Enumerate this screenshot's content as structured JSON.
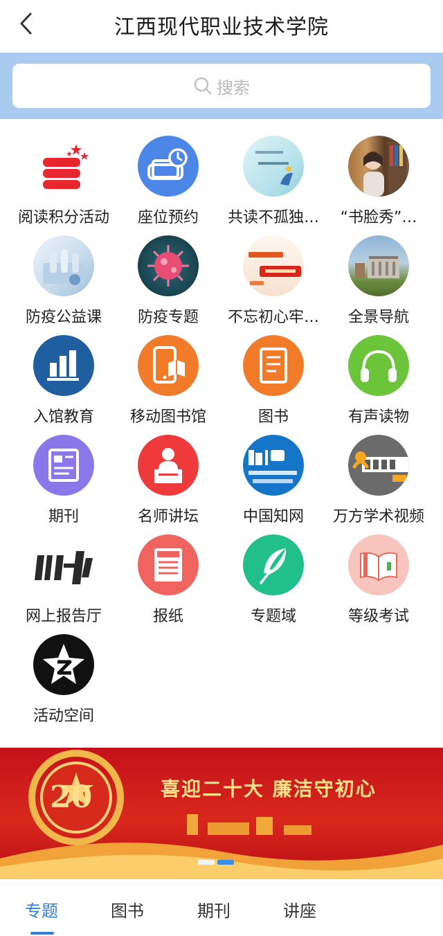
{
  "header": {
    "title": "江西现代职业技术学院",
    "back_icon": "chevron-left-icon"
  },
  "search": {
    "placeholder": "搜索",
    "icon": "search-icon"
  },
  "grid": {
    "items": [
      {
        "label": "阅读积分活动",
        "icon": "stacked-books-stars-icon"
      },
      {
        "label": "座位预约",
        "icon": "seat-clock-icon"
      },
      {
        "label": "共读不孤独…",
        "icon": "reading-poster-thumbnail"
      },
      {
        "label": "“书脸秀”…",
        "icon": "portrait-photo-thumbnail"
      },
      {
        "label": "防疫公益课",
        "icon": "lab-photo-thumbnail"
      },
      {
        "label": "防疫专题",
        "icon": "virus-thumbnail"
      },
      {
        "label": "不忘初心牢…",
        "icon": "mission-poster-thumbnail"
      },
      {
        "label": "全景导航",
        "icon": "building-photo-thumbnail"
      },
      {
        "label": "入馆教育",
        "icon": "bar-chart-icon"
      },
      {
        "label": "移动图书馆",
        "icon": "mobile-book-icon"
      },
      {
        "label": "图书",
        "icon": "book-icon"
      },
      {
        "label": "有声读物",
        "icon": "headphones-icon"
      },
      {
        "label": "期刊",
        "icon": "journal-icon"
      },
      {
        "label": "名师讲坛",
        "icon": "lecturer-podium-icon"
      },
      {
        "label": "中国知网",
        "icon": "cnki-logo"
      },
      {
        "label": "万方学术视频",
        "icon": "wanfang-logo"
      },
      {
        "label": "网上报告厅",
        "icon": "report-hall-logo"
      },
      {
        "label": "报纸",
        "icon": "newspaper-icon"
      },
      {
        "label": "专题域",
        "icon": "feather-icon"
      },
      {
        "label": "等级考试",
        "icon": "open-book-icon"
      },
      {
        "label": "活动空间",
        "icon": "star-z-icon"
      }
    ]
  },
  "banner": {
    "headline": "喜迎二十大  廉洁守初心",
    "logo_text": "20",
    "slides_total": 2,
    "slide_active": 2
  },
  "tabs": [
    {
      "label": "专题",
      "active": true
    },
    {
      "label": "图书",
      "active": false
    },
    {
      "label": "期刊",
      "active": false
    },
    {
      "label": "讲座",
      "active": false
    }
  ],
  "colors": {
    "accent": "#2f7fd8",
    "search_band": "#a9cbf0",
    "banner_red": "#c4121a"
  }
}
